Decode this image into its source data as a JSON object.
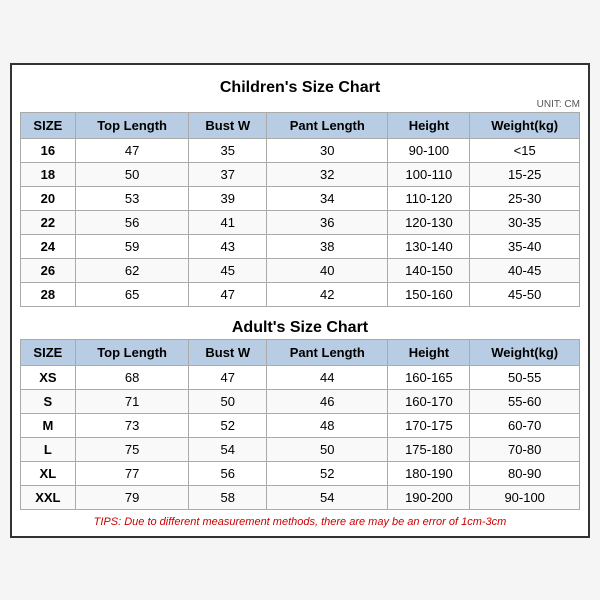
{
  "children": {
    "title": "Children's Size Chart",
    "unit": "UNIT: CM",
    "headers": [
      "SIZE",
      "Top Length",
      "Bust W",
      "Pant Length",
      "Height",
      "Weight(kg)"
    ],
    "rows": [
      [
        "16",
        "47",
        "35",
        "30",
        "90-100",
        "<15"
      ],
      [
        "18",
        "50",
        "37",
        "32",
        "100-110",
        "15-25"
      ],
      [
        "20",
        "53",
        "39",
        "34",
        "110-120",
        "25-30"
      ],
      [
        "22",
        "56",
        "41",
        "36",
        "120-130",
        "30-35"
      ],
      [
        "24",
        "59",
        "43",
        "38",
        "130-140",
        "35-40"
      ],
      [
        "26",
        "62",
        "45",
        "40",
        "140-150",
        "40-45"
      ],
      [
        "28",
        "65",
        "47",
        "42",
        "150-160",
        "45-50"
      ]
    ]
  },
  "adults": {
    "title": "Adult's Size Chart",
    "headers": [
      "SIZE",
      "Top Length",
      "Bust W",
      "Pant Length",
      "Height",
      "Weight(kg)"
    ],
    "rows": [
      [
        "XS",
        "68",
        "47",
        "44",
        "160-165",
        "50-55"
      ],
      [
        "S",
        "71",
        "50",
        "46",
        "160-170",
        "55-60"
      ],
      [
        "M",
        "73",
        "52",
        "48",
        "170-175",
        "60-70"
      ],
      [
        "L",
        "75",
        "54",
        "50",
        "175-180",
        "70-80"
      ],
      [
        "XL",
        "77",
        "56",
        "52",
        "180-190",
        "80-90"
      ],
      [
        "XXL",
        "79",
        "58",
        "54",
        "190-200",
        "90-100"
      ]
    ]
  },
  "tips": "TIPS: Due to different measurement methods, there are may be an error of 1cm-3cm"
}
